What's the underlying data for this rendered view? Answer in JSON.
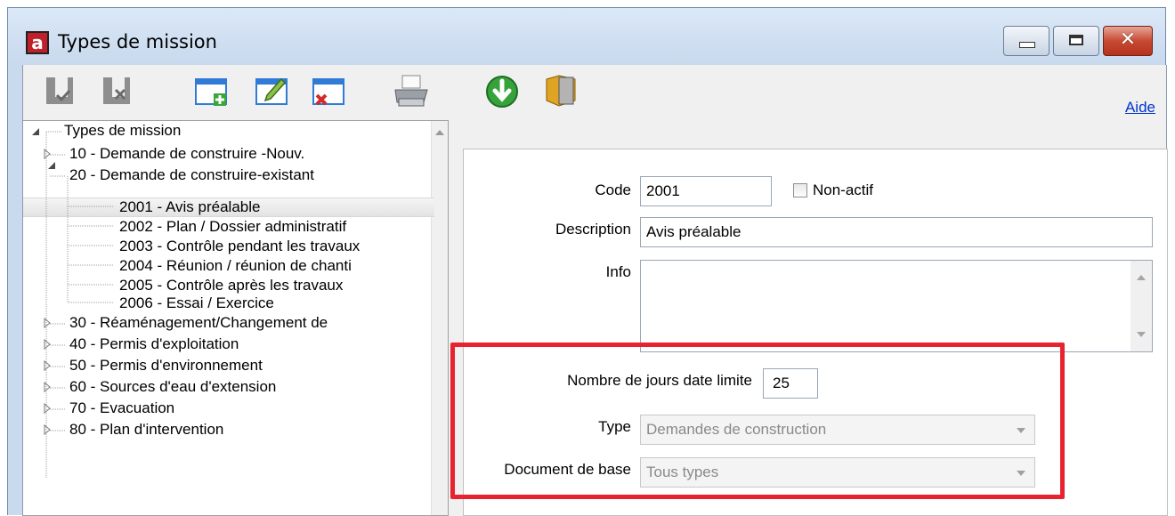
{
  "window": {
    "title": "Types de mission",
    "app_icon_letter": "a",
    "controls": [
      "minimize-icon",
      "maximize-icon",
      "close-icon"
    ]
  },
  "toolbar": {
    "buttons": [
      {
        "name": "save-check",
        "icon": "save-check-icon"
      },
      {
        "name": "save-cancel",
        "icon": "save-cancel-icon"
      },
      {
        "name": "add",
        "icon": "window-add-icon"
      },
      {
        "name": "edit",
        "icon": "window-edit-icon"
      },
      {
        "name": "delete",
        "icon": "window-delete-icon"
      },
      {
        "name": "print",
        "icon": "printer-icon"
      },
      {
        "name": "download",
        "icon": "green-down-arrow-icon"
      },
      {
        "name": "exit",
        "icon": "door-exit-icon"
      }
    ],
    "help_label": "Aide"
  },
  "tree": {
    "root": "Types de mission",
    "items": [
      {
        "label": "10  -  Demande de construire -Nouv.",
        "level": 1,
        "state": "collapsed"
      },
      {
        "label": "20  -  Demande de construire-existant",
        "level": 1,
        "state": "expanded"
      },
      {
        "label": "2001  -  Avis préalable",
        "level": 2,
        "selected": true
      },
      {
        "label": "2002  -  Plan / Dossier administratif",
        "level": 2
      },
      {
        "label": "2003  -  Contrôle pendant les travaux",
        "level": 2
      },
      {
        "label": "2004  -  Réunion / réunion de chanti",
        "level": 2
      },
      {
        "label": "2005  -  Contrôle après les travaux",
        "level": 2
      },
      {
        "label": "2006  -  Essai / Exercice",
        "level": 2
      },
      {
        "label": "30  -  Réaménagement/Changement de",
        "level": 1,
        "state": "collapsed"
      },
      {
        "label": "40  -  Permis d'exploitation",
        "level": 1,
        "state": "collapsed"
      },
      {
        "label": "50  -  Permis d'environnement",
        "level": 1,
        "state": "collapsed"
      },
      {
        "label": "60  -  Sources d'eau d'extension",
        "level": 1,
        "state": "collapsed"
      },
      {
        "label": "70  -  Evacuation",
        "level": 1,
        "state": "collapsed"
      },
      {
        "label": "80  -  Plan d'intervention",
        "level": 1,
        "state": "collapsed"
      }
    ]
  },
  "form": {
    "code_label": "Code",
    "code_value": "2001",
    "inactive_label": "Non-actif",
    "inactive_checked": false,
    "description_label": "Description",
    "description_value": "Avis préalable",
    "info_label": "Info",
    "info_value": "",
    "days_label": "Nombre de jours date limite",
    "days_value": "25",
    "type_label": "Type",
    "type_value": "Demandes de construction",
    "base_doc_label": "Document de base",
    "base_doc_value": "Tous types"
  },
  "colors": {
    "highlight": "#e8232f",
    "link": "#0033cc",
    "disabled_text": "#8a8a8a"
  }
}
